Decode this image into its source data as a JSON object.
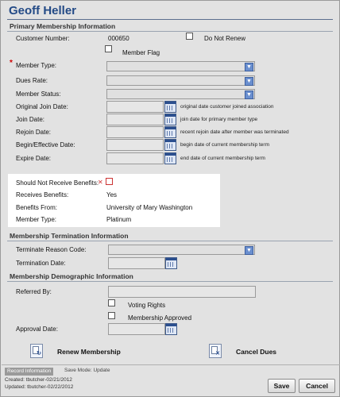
{
  "title": "Geoff Heller",
  "primary": {
    "heading": "Primary Membership Information",
    "customer_number_label": "Customer Number:",
    "customer_number": "000650",
    "do_not_renew_label": "Do Not Renew",
    "member_flag_label": "Member Flag",
    "member_type_label": "Member Type:",
    "dues_rate_label": "Dues Rate:",
    "member_status_label": "Member Status:",
    "original_join_label": "Original Join Date:",
    "original_join_hint": "original date customer joined association",
    "join_label": "Join Date:",
    "join_hint": "join date for primary member type",
    "rejoin_label": "Rejoin Date:",
    "rejoin_hint": "recent rejoin date after member was terminated",
    "begin_label": "Begin/Effective Date:",
    "begin_hint": "begin date of current membership term",
    "expire_label": "Expire Date:",
    "expire_hint": "end date of current membership term"
  },
  "benefits": {
    "should_not_label": "Should Not Receive Benefits:",
    "receives_label": "Receives Benefits:",
    "receives_value": "Yes",
    "from_label": "Benefits From:",
    "from_value": "University of Mary Washington",
    "type_label": "Member Type:",
    "type_value": "Platinum"
  },
  "termination": {
    "heading": "Membership Termination Information",
    "reason_label": "Terminate Reason Code:",
    "date_label": "Termination Date:"
  },
  "demographic": {
    "heading": "Membership Demographic Information",
    "referred_label": "Referred By:",
    "voting_label": "Voting Rights",
    "approved_label": "Membership Approved",
    "approval_date_label": "Approval Date:"
  },
  "actions": {
    "renew": "Renew Membership",
    "cancel_dues": "Cancel Dues"
  },
  "footer": {
    "record_tab": "Record Information",
    "save_mode": "Save Mode: Update",
    "created": "Created: tbutcher-02/21/2012",
    "updated": "Updated: tbutcher-02/22/2012",
    "save": "Save",
    "cancel": "Cancel"
  }
}
